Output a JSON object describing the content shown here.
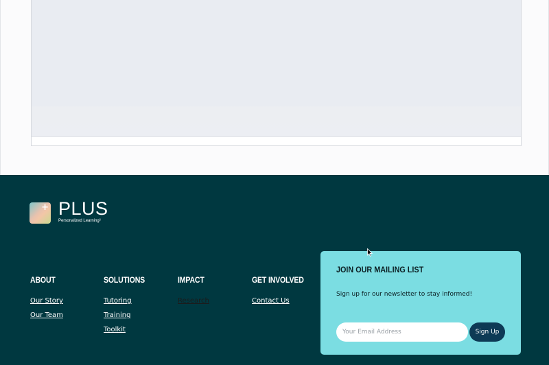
{
  "brand": {
    "name": "PLUS",
    "tagline": "Personalized Learning²",
    "mark_symbol": "+"
  },
  "footer": {
    "columns": [
      {
        "heading": "ABOUT",
        "links": [
          "Our Story",
          "Our Team"
        ]
      },
      {
        "heading": "SOLUTIONS",
        "links": [
          "Tutoring",
          "Training",
          "Toolkit"
        ]
      },
      {
        "heading": "IMPACT",
        "links": [
          "Research"
        ]
      },
      {
        "heading": "GET INVOLVED",
        "links": [
          "Contact Us"
        ]
      }
    ]
  },
  "mailing_list": {
    "title": "JOIN OUR MAILING LIST",
    "description": "Sign up for our newsletter to stay informed!",
    "email_placeholder": "Your Email Address",
    "button_label": "Sign Up"
  },
  "colors": {
    "footer_bg": "#003840",
    "card_bg": "#7bdde2",
    "button_bg": "#0d3a55"
  }
}
